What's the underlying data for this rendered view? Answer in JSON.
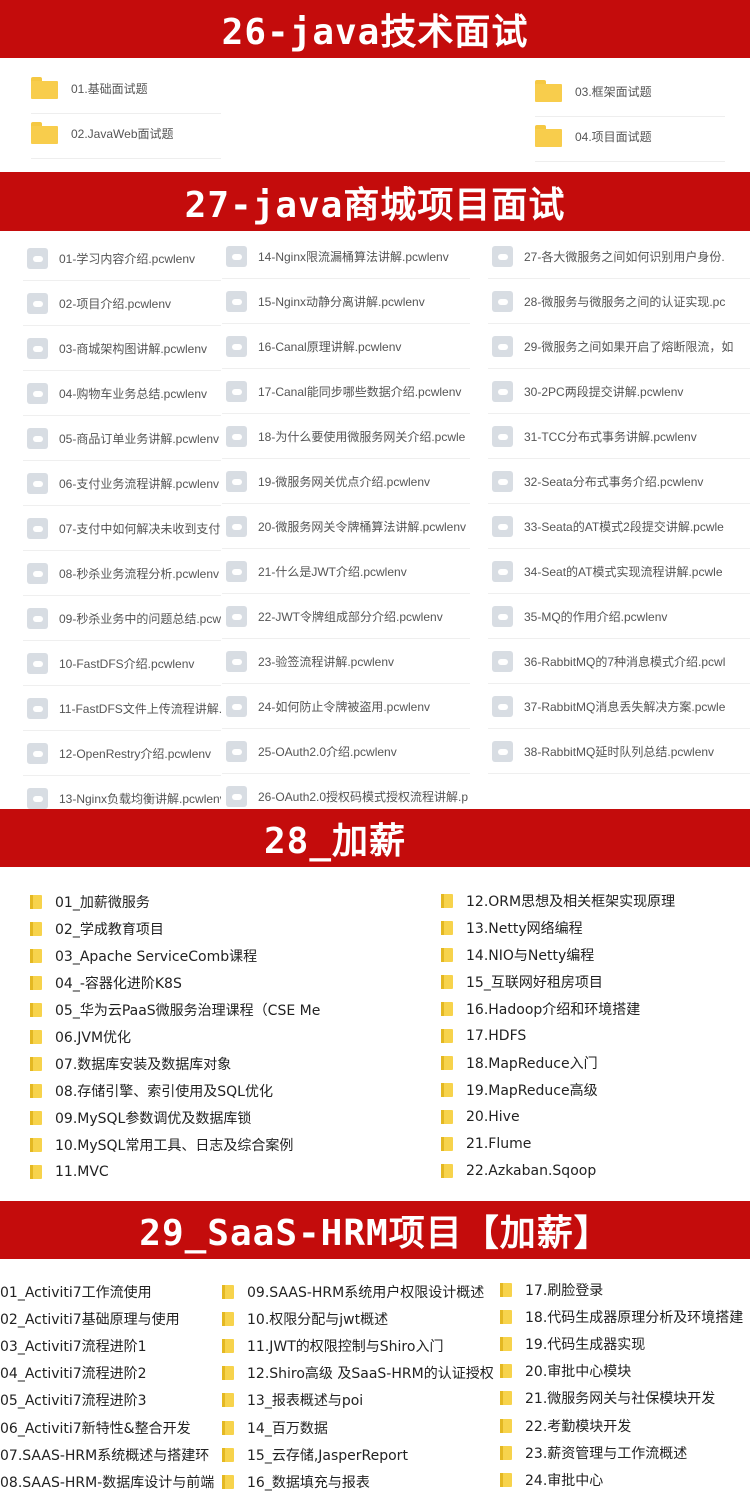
{
  "sections": {
    "s26": {
      "title": "26-java技术面试",
      "folders": [
        "01.基础面试题",
        "02.JavaWeb面试题",
        "03.框架面试题",
        "04.项目面试题"
      ]
    },
    "s27": {
      "title": "27-java商城项目面试",
      "col1": [
        "01-学习内容介绍.pcwlenv",
        "02-项目介绍.pcwlenv",
        "03-商城架构图讲解.pcwlenv",
        "04-购物车业务总结.pcwlenv",
        "05-商品订单业务讲解.pcwlenv",
        "06-支付业务流程讲解.pcwlenv",
        "07-支付中如何解决未收到支付",
        "08-秒杀业务流程分析.pcwlenv",
        "09-秒杀业务中的问题总结.pcwlenv",
        "10-FastDFS介绍.pcwlenv",
        "11-FastDFS文件上传流程讲解.",
        "12-OpenRestry介绍.pcwlenv",
        "13-Nginx负载均衡讲解.pcwlenv"
      ],
      "col2": [
        "14-Nginx限流漏桶算法讲解.pcwlenv",
        "15-Nginx动静分离讲解.pcwlenv",
        "16-Canal原理讲解.pcwlenv",
        "17-Canal能同步哪些数据介绍.pcwlenv",
        "18-为什么要使用微服务网关介绍.pcwle",
        "19-微服务网关优点介绍.pcwlenv",
        "20-微服务网关令牌桶算法讲解.pcwlenv",
        "21-什么是JWT介绍.pcwlenv",
        "22-JWT令牌组成部分介绍.pcwlenv",
        "23-验签流程讲解.pcwlenv",
        "24-如何防止令牌被盗用.pcwlenv",
        "25-OAuth2.0介绍.pcwlenv",
        "26-OAuth2.0授权码模式授权流程讲解.p"
      ],
      "col3": [
        "27-各大微服务之间如何识别用户身份.",
        "28-微服务与微服务之间的认证实现.pc",
        "29-微服务之间如果开启了熔断限流，如",
        "30-2PC两段提交讲解.pcwlenv",
        "31-TCC分布式事务讲解.pcwlenv",
        "32-Seata分布式事务介绍.pcwlenv",
        "33-Seata的AT模式2段提交讲解.pcwle",
        "34-Seat的AT模式实现流程讲解.pcwle",
        "35-MQ的作用介绍.pcwlenv",
        "36-RabbitMQ的7种消息模式介绍.pcwl",
        "37-RabbitMQ消息丢失解决方案.pcwle",
        "38-RabbitMQ延时队列总结.pcwlenv"
      ]
    },
    "s28": {
      "title": "28_加薪",
      "col1": [
        "01_加薪微服务",
        "02_学成教育项目",
        "03_Apache ServiceComb课程",
        "04_-容器化进阶K8S",
        "05_华为云PaaS微服务治理课程（CSE Me",
        "06.JVM优化",
        "07.数据库安装及数据库对象",
        "08.存储引擎、索引使用及SQL优化",
        "09.MySQL参数调优及数据库锁",
        "10.MySQL常用工具、日志及综合案例",
        "11.MVC"
      ],
      "col2": [
        "12.ORM思想及相关框架实现原理",
        "13.Netty网络编程",
        "14.NIO与Netty编程",
        "15_互联网好租房项目",
        "16.Hadoop介绍和环境搭建",
        "17.HDFS",
        "18.MapReduce入门",
        "19.MapReduce高级",
        "20.Hive",
        "21.Flume",
        "22.Azkaban.Sqoop"
      ]
    },
    "s29": {
      "title": "29_SaaS-HRM项目【加薪】",
      "col1": [
        "01_Activiti7工作流使用",
        "02_Activiti7基础原理与使用",
        "03_Activiti7流程进阶1",
        "04_Activiti7流程进阶2",
        "05_Activiti7流程进阶3",
        "06_Activiti7新特性&整合开发",
        "07.SAAS-HRM系统概述与搭建环",
        "08.SAAS-HRM-数据库设计与前端"
      ],
      "col2": [
        "09.SAAS-HRM系统用户权限设计概述",
        "10.权限分配与jwt概述",
        "11.JWT的权限控制与Shiro入门",
        "12.Shiro高级 及SaaS-HRM的认证授权",
        "13_报表概述与poi",
        "14_百万数据",
        "15_云存储,JasperReport",
        "16_数据填充与报表"
      ],
      "col3": [
        "17.刷脸登录",
        "18.代码生成器原理分析及环境搭建",
        "19.代码生成器实现",
        "20.审批中心模块",
        "21.微服务网关与社保模块开发",
        "22.考勤模块开发",
        "23.薪资管理与工作流概述",
        "24.审批中心"
      ]
    }
  }
}
